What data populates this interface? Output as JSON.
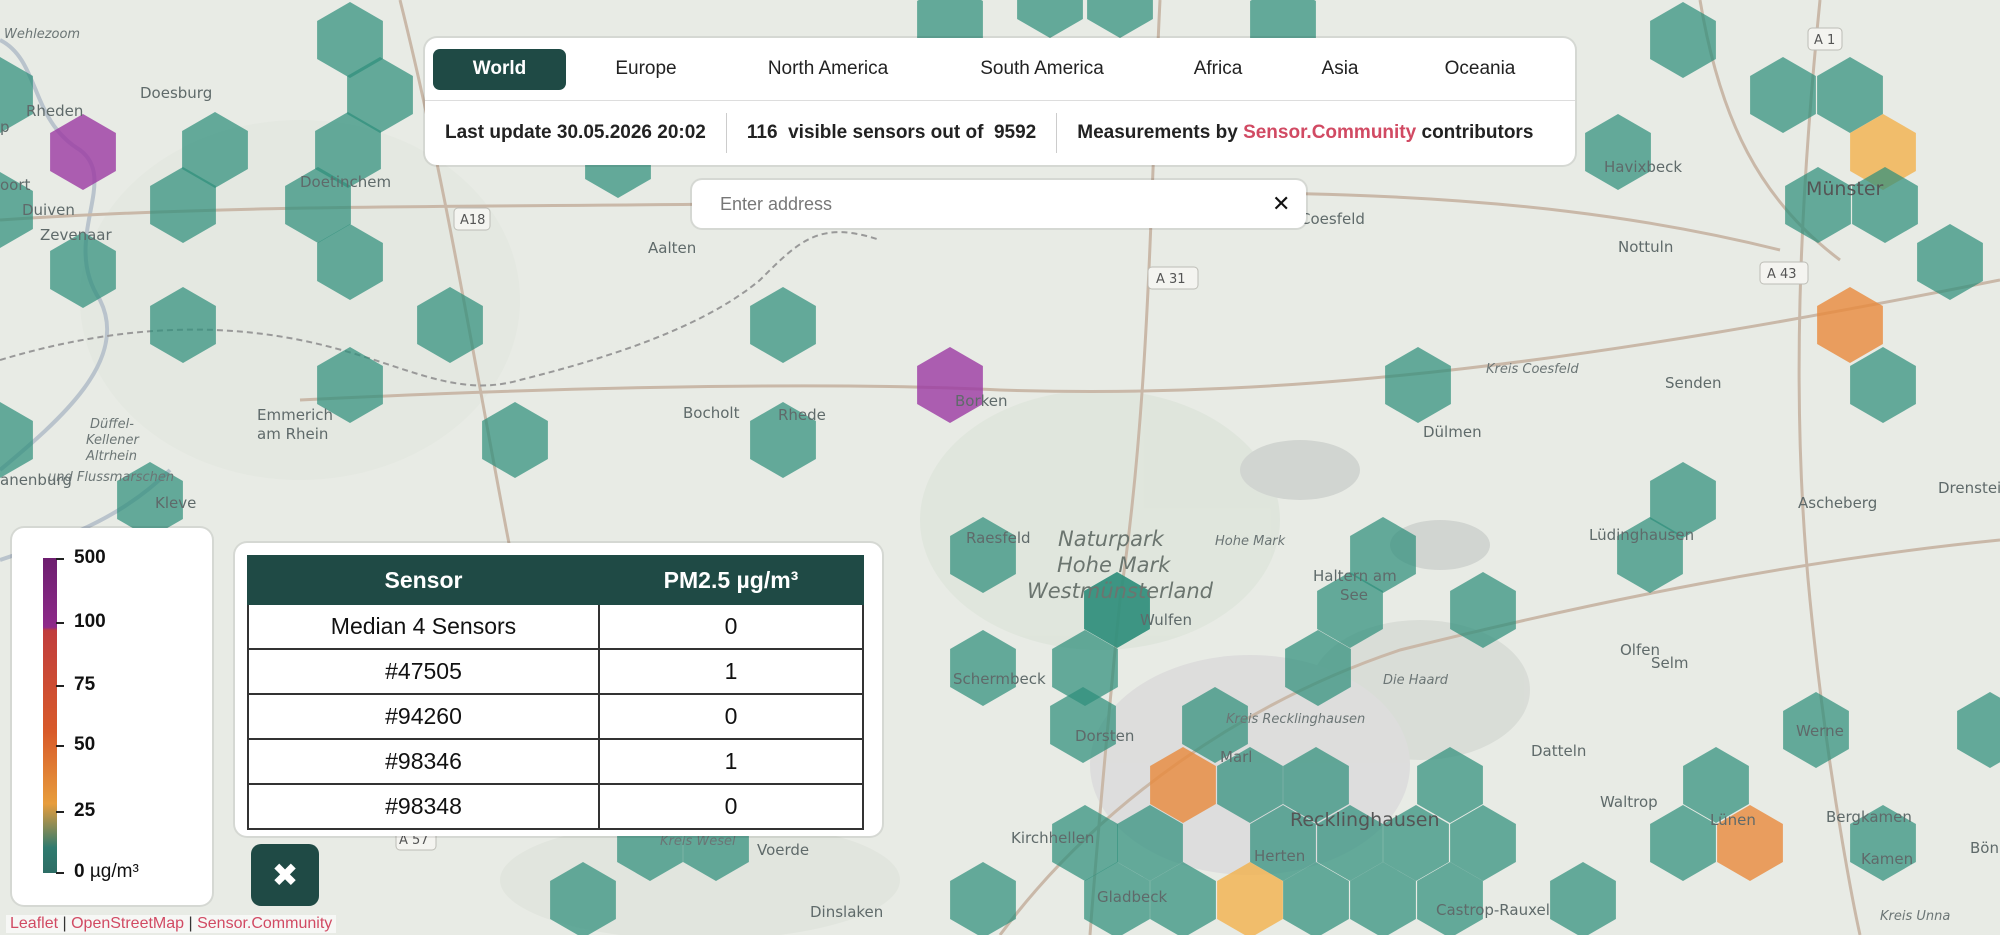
{
  "tabs": [
    "World",
    "Europe",
    "North America",
    "South America",
    "Africa",
    "Asia",
    "Oceania"
  ],
  "active_tab": "World",
  "info": {
    "last_update": "Last update 30.05.2026 20:02",
    "visible_count": "116",
    "visible_text": "visible sensors out of",
    "total_count": "9592",
    "measurements_prefix": "Measurements by",
    "measurements_brand": "Sensor.Community",
    "measurements_suffix": "contributors"
  },
  "search": {
    "placeholder": "Enter address",
    "clear_icon": "close-icon"
  },
  "legend": {
    "labels": [
      "500",
      "100",
      "75",
      "50",
      "25",
      "0"
    ],
    "unit": "µg/m³"
  },
  "sensor_table": {
    "headers": [
      "Sensor",
      "PM2.5 µg/m³"
    ],
    "rows": [
      [
        "Median 4 Sensors",
        "0"
      ],
      [
        "#47505",
        "1"
      ],
      [
        "#94260",
        "0"
      ],
      [
        "#98346",
        "1"
      ],
      [
        "#98348",
        "0"
      ]
    ]
  },
  "close_button_icon": "close-icon",
  "attribution": [
    "Leaflet",
    "OpenStreetMap",
    "Sensor.Community"
  ],
  "map": {
    "places": [
      "Wehlezoom",
      "Rheden",
      "Doesburg",
      "Duiven",
      "Zevenaar",
      "Doetinchem",
      "Aalten",
      "Emmerich am Rhein",
      "Bocholt",
      "Rhede",
      "Borken",
      "Dülmen",
      "Coesfeld",
      "Nottuln",
      "Havixbeck",
      "Münster",
      "Senden",
      "Ascheberg",
      "Drensteinf",
      "Lüdinghausen",
      "Olfen",
      "Selm",
      "Werne",
      "Datteln",
      "Waltrop",
      "Lünen",
      "Bergkamen",
      "Kamen",
      "Bön",
      "Recklinghausen",
      "Herten",
      "Marl",
      "Dorsten",
      "Wulfen",
      "Haltern am See",
      "Schermbeck",
      "Raesfeld",
      "Kirchhellen",
      "Gladbeck",
      "Castrop-Rauxel",
      "Dinslaken",
      "Voerde",
      "Kleve",
      "Kreis Coesfeld",
      "Kreis Recklinghausen",
      "Kreis Wesel",
      "Kreis Unna",
      "Hohe Mark",
      "Die Haard",
      "Düffel-Kellener Altrhein und Flussmarschen",
      "anenburg",
      "oort",
      "p"
    ],
    "park": [
      "Naturpark",
      "Hohe Mark",
      "Westmünsterland"
    ],
    "road_signs": [
      "A 1",
      "A18",
      "A 31",
      "A 43",
      "A 57"
    ],
    "colors": {
      "teal": "#2f8f7c",
      "purple": "#9b3aa3",
      "orange": "#e88a3c",
      "amber": "#f2b24c",
      "accent": "#1f4a45"
    }
  }
}
